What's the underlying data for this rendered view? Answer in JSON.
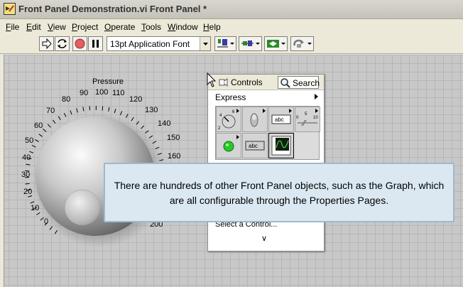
{
  "window": {
    "title": "Front Panel Demonstration.vi Front Panel *"
  },
  "menu": {
    "items": [
      {
        "accel": "F",
        "rest": "ile"
      },
      {
        "accel": "E",
        "rest": "dit"
      },
      {
        "accel": "V",
        "rest": "iew"
      },
      {
        "accel": "P",
        "rest": "roject"
      },
      {
        "accel": "O",
        "rest": "perate"
      },
      {
        "accel": "T",
        "rest": "ools"
      },
      {
        "accel": "W",
        "rest": "indow"
      },
      {
        "accel": "H",
        "rest": "elp"
      }
    ]
  },
  "toolbar": {
    "run_icon": "run-arrow-icon",
    "run_continuous_icon": "run-continuously-icon",
    "abort_icon": "abort-stop-icon",
    "pause_icon": "pause-icon",
    "font": "13pt Application Font",
    "align_icon": "align-objects-icon",
    "distribute_icon": "distribute-objects-icon",
    "resize_icon": "resize-objects-icon",
    "reorder_icon": "reorder-icon"
  },
  "knob": {
    "label": "Pressure",
    "scale": [
      "0",
      "10",
      "20",
      "30",
      "40",
      "50",
      "60",
      "70",
      "80",
      "90",
      "100",
      "110",
      "120",
      "130",
      "140",
      "150",
      "160",
      "200"
    ]
  },
  "palette": {
    "title": "Controls",
    "search": "Search",
    "category": "Express",
    "select_control": "Select a Control...",
    "more": "∨",
    "cells": [
      "numeric-controls-icon",
      "buttons-switches-icon",
      "text-controls-icon",
      "slide-controls-icon",
      "led-indicator-icon",
      "text-indicator-icon",
      "graph-indicator-icon"
    ]
  },
  "tooltip": {
    "line1": "There are hundreds of other Front Panel objects, such as the Graph, which",
    "line2": "are all configurable through the Properties Pages."
  },
  "colors": {
    "accent": "#e06060",
    "tooltip_bg": "#dbe8f2",
    "led_green": "#22cc22"
  }
}
